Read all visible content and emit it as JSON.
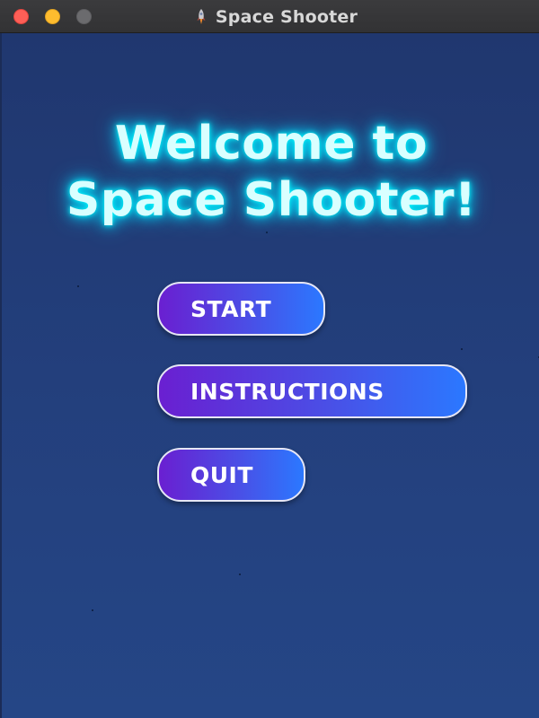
{
  "window": {
    "title": "Space Shooter",
    "app_icon": "rocket-icon"
  },
  "screen": {
    "welcome_line1": "Welcome to",
    "welcome_line2": "Space Shooter!"
  },
  "menu": {
    "start_label": "START",
    "instructions_label": "INSTRUCTIONS",
    "quit_label": "QUIT"
  },
  "colors": {
    "background": "#233f7e",
    "title_glow": "#00ffff",
    "button_gradient_start": "#6a1fd1",
    "button_gradient_end": "#2b78ff",
    "button_border": "#e6e6f5"
  }
}
